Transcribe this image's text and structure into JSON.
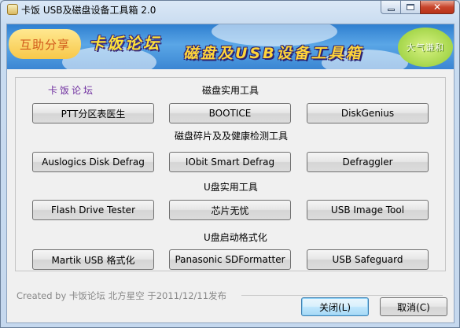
{
  "window": {
    "title": "卡饭 USB及磁盘设备工具箱 2.0"
  },
  "banner": {
    "mutual_share": "互助分享",
    "brand": "卡饭论坛",
    "title": "磁盘及USB设备工具箱",
    "tagline": "大气谦和"
  },
  "forum_link": "卡饭论坛",
  "sections": {
    "disk_tools": "磁盘实用工具",
    "defrag_health": "磁盘碎片及及健康检测工具",
    "usb_tools": "U盘实用工具",
    "usb_boot_format": "U盘启动格式化"
  },
  "buttons": {
    "ptt": "PTT分区表医生",
    "bootice": "BOOTICE",
    "diskgenius": "DiskGenius",
    "auslogics": "Auslogics Disk Defrag",
    "iobit": "IObit Smart Defrag",
    "defraggler": "Defraggler",
    "flash_tester": "Flash Drive Tester",
    "chip_wuyou": "芯片无忧",
    "usb_image_tool": "USB Image Tool",
    "martik": "Martik USB 格式化",
    "panasonic": "Panasonic SDFormatter",
    "usb_safeguard": "USB Safeguard"
  },
  "footer": {
    "credit": "Created by 卡饭论坛 北方星空 于2011/12/11发布",
    "close_label": "关闭(L)",
    "cancel_label": "取消(C)"
  },
  "colors": {
    "link": "#7030a0",
    "default_button_border": "#3c7fb1"
  }
}
